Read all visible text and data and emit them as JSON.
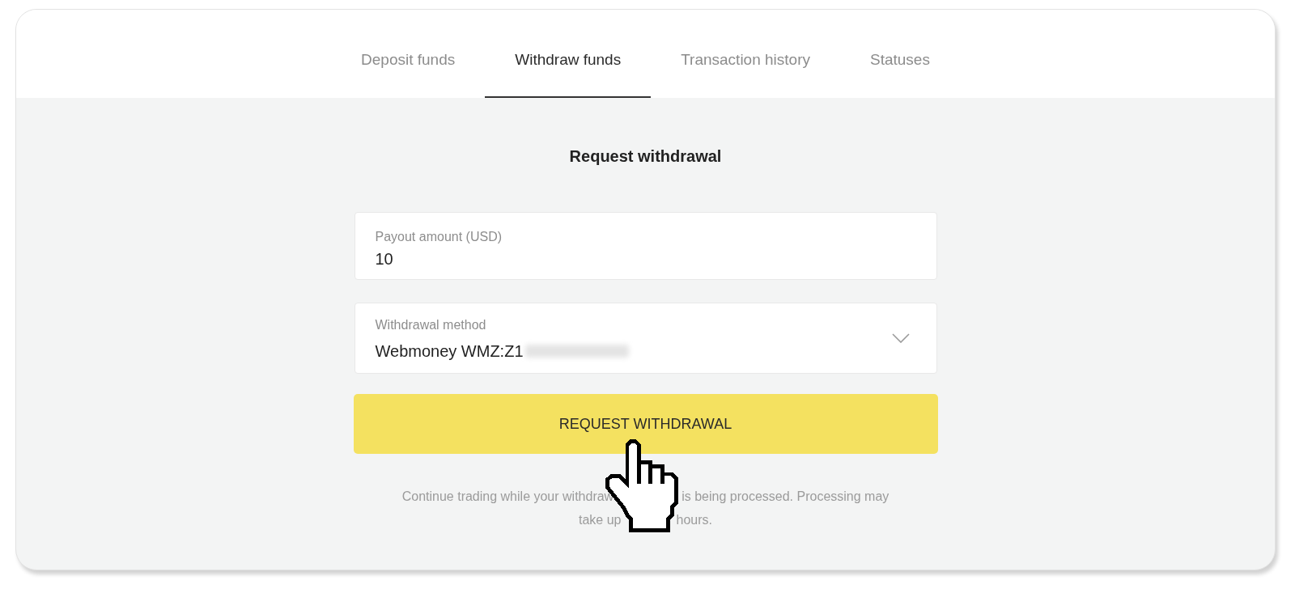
{
  "tabs": [
    {
      "label": "Deposit funds",
      "selected": false
    },
    {
      "label": "Withdraw funds",
      "selected": true
    },
    {
      "label": "Transaction history",
      "selected": false
    },
    {
      "label": "Statuses",
      "selected": false
    }
  ],
  "form": {
    "title": "Request withdrawal",
    "fields": [
      {
        "kind": "input",
        "label": "Payout amount (USD)",
        "value": "10",
        "value_redacted": false
      },
      {
        "kind": "select",
        "label": "Withdrawal method",
        "value": "Webmoney WMZ:Z1",
        "value_redacted": true
      }
    ],
    "submit_button": "REQUEST WITHDRAWAL",
    "note_lines": [
      {
        "before": "Continue trading while your withdraw",
        "after": "is being processed. Processing may"
      },
      {
        "before": "take up",
        "after": "hours."
      }
    ]
  }
}
